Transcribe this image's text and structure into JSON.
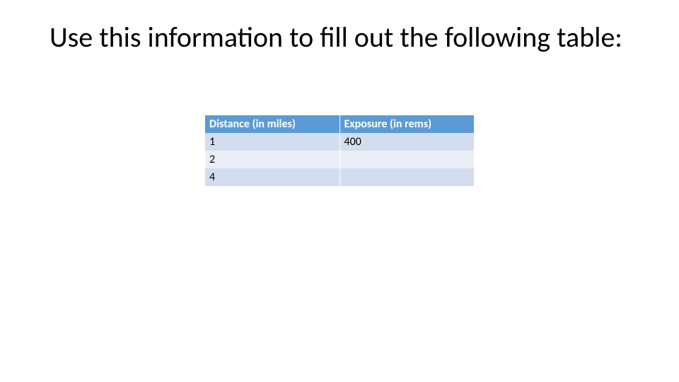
{
  "title": "Use this information to fill out the following table:",
  "chart_data": {
    "type": "table",
    "columns": [
      "Distance (in miles)",
      "Exposure (in rems)"
    ],
    "rows": [
      {
        "distance": "1",
        "exposure": "400"
      },
      {
        "distance": "2",
        "exposure": ""
      },
      {
        "distance": "4",
        "exposure": ""
      }
    ]
  }
}
